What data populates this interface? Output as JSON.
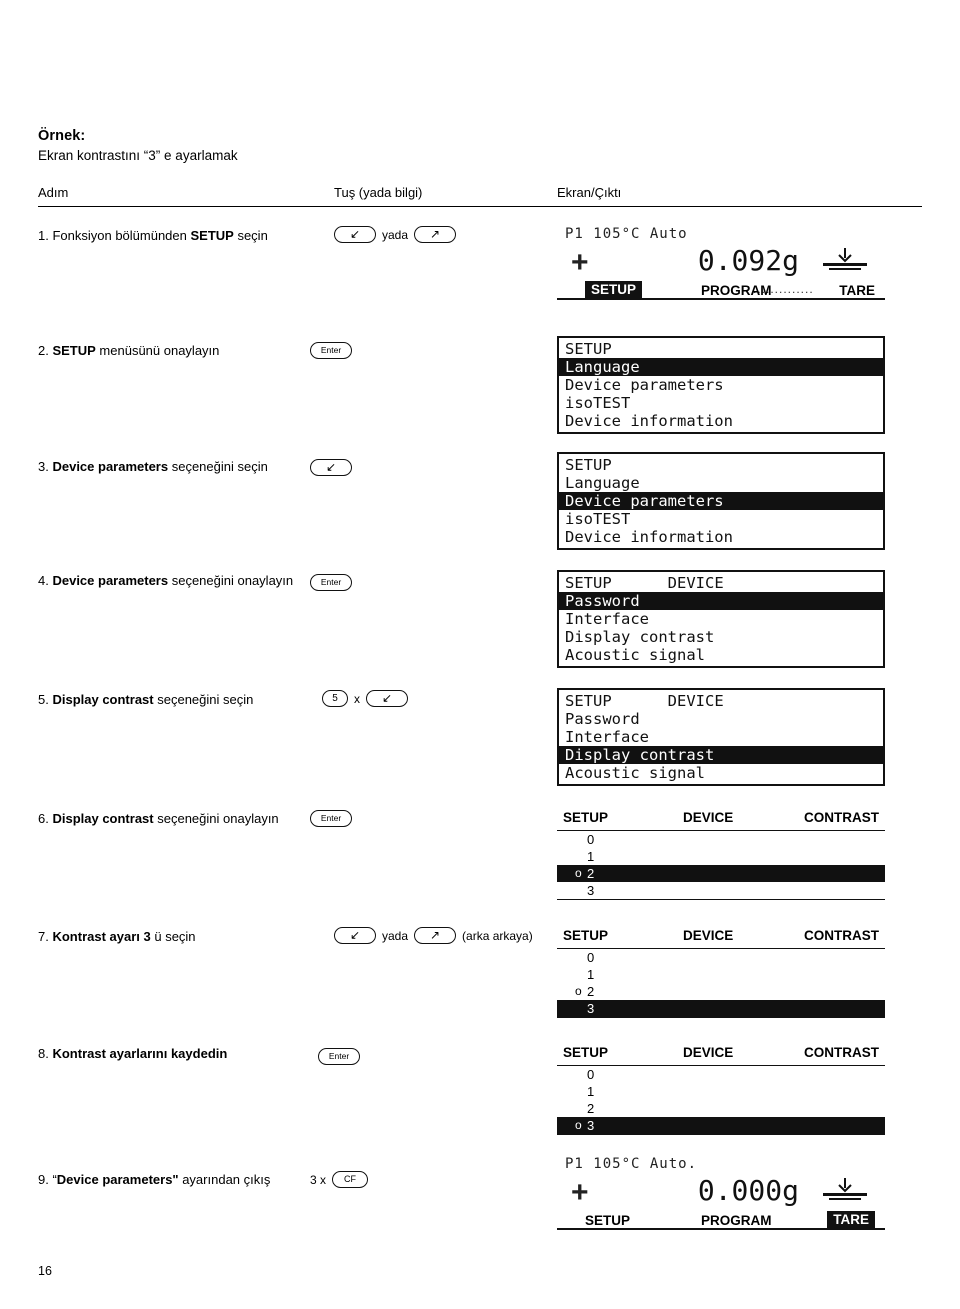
{
  "document": {
    "example_label": "Örnek:",
    "example_sub": "Ekran kontrastını “3” e ayarlamak",
    "columns": {
      "step": "Adım",
      "key": "Tuş (yada bilgi)",
      "display": "Ekran/Çıktı"
    },
    "page_number": "16"
  },
  "keys": {
    "down_arrow": "↙",
    "up_arrow": "↗",
    "enter": "Enter",
    "five": "5",
    "cf": "CF",
    "or": "yada",
    "times": "x",
    "back_note": "(arka arkaya)",
    "three_times": "3 x"
  },
  "steps": [
    {
      "n": "1.",
      "text": "Fonksiyon bölümünden SETUP seçin",
      "bold_part": "SETUP",
      "keys": [
        "↙",
        "yada",
        "↗"
      ]
    },
    {
      "n": "2.",
      "text": "SETUP menüsünü onaylayın",
      "bold_part": "SETUP",
      "keys": [
        "Enter"
      ]
    },
    {
      "n": "3.",
      "text": "Device parameters seçeneğini seçin",
      "bold_part": "Device parameters",
      "keys": [
        "↙"
      ]
    },
    {
      "n": "4.",
      "text": "Device parameters seçeneğini onaylayın",
      "bold_part": "Device parameters",
      "keys": [
        "Enter"
      ]
    },
    {
      "n": "5.",
      "text": "Display contrast seçeneğini seçin",
      "bold_part": "Display contrast",
      "keys": [
        "5",
        "x",
        "↙"
      ]
    },
    {
      "n": "6.",
      "text": "Display contrast seçeneğini onaylayın",
      "bold_part": "Display contrast",
      "keys": [
        "Enter"
      ]
    },
    {
      "n": "7.",
      "text": "Kontrast ayarı 3 ü seçin",
      "bold_part": "Kontrast ayarı 3",
      "keys": [
        "↙",
        "yada",
        "↗",
        "(arka arkaya)"
      ]
    },
    {
      "n": "8.",
      "text": "Kontrast ayarlarını kaydedin",
      "bold_part": "Kontrast ayarlarını kaydedin",
      "keys": [
        "Enter"
      ]
    },
    {
      "n": "9.",
      "text": "“Device parameters\" ayarından çıkış",
      "bold_part": "Device parameters\"",
      "keys": [
        "3 x",
        "CF"
      ]
    }
  ],
  "displays": {
    "weight_top": {
      "status_line": "P1  105°C  Auto",
      "sign": "+",
      "value": "0.092g",
      "soft_setup": "SETUP",
      "soft_program": "PROGRAM",
      "soft_tare": "TARE"
    },
    "weight_bottom": {
      "status_line": "P1  105°C  Auto.",
      "sign": "+",
      "value": "0.000g",
      "soft_setup": "SETUP",
      "soft_program": "PROGRAM",
      "soft_tare": "TARE"
    },
    "menu_step2": {
      "title": "SETUP",
      "items": [
        "Language",
        "Device parameters",
        "isoTEST",
        "Device information"
      ],
      "selected_index": 0
    },
    "menu_step3": {
      "title": "SETUP",
      "items": [
        "Language",
        "Device parameters",
        "isoTEST",
        "Device information"
      ],
      "selected_index": 1
    },
    "menu_step4": {
      "title": "SETUP",
      "title2": "DEVICE",
      "items": [
        "Password",
        "Interface",
        "Display contrast",
        "Acoustic signal"
      ],
      "selected_index": 0
    },
    "menu_step5": {
      "title": "SETUP",
      "title2": "DEVICE",
      "items": [
        "Password",
        "Interface",
        "Display contrast",
        "Acoustic signal"
      ],
      "selected_index": 2
    },
    "contrast_step6": {
      "h1": "SETUP",
      "h2": "DEVICE",
      "h3": "CONTRAST",
      "options": [
        "0",
        "1",
        "2",
        "3"
      ],
      "marked_index": 2,
      "selected_index": 2,
      "mark_char": "o"
    },
    "contrast_step7": {
      "h1": "SETUP",
      "h2": "DEVICE",
      "h3": "CONTRAST",
      "options": [
        "0",
        "1",
        "2",
        "3"
      ],
      "marked_index": 2,
      "selected_index": 3,
      "mark_char": "o"
    },
    "contrast_step8": {
      "h1": "SETUP",
      "h2": "DEVICE",
      "h3": "CONTRAST",
      "options": [
        "0",
        "1",
        "2",
        "3"
      ],
      "marked_index": 3,
      "selected_index": 3,
      "mark_char": "o"
    }
  }
}
